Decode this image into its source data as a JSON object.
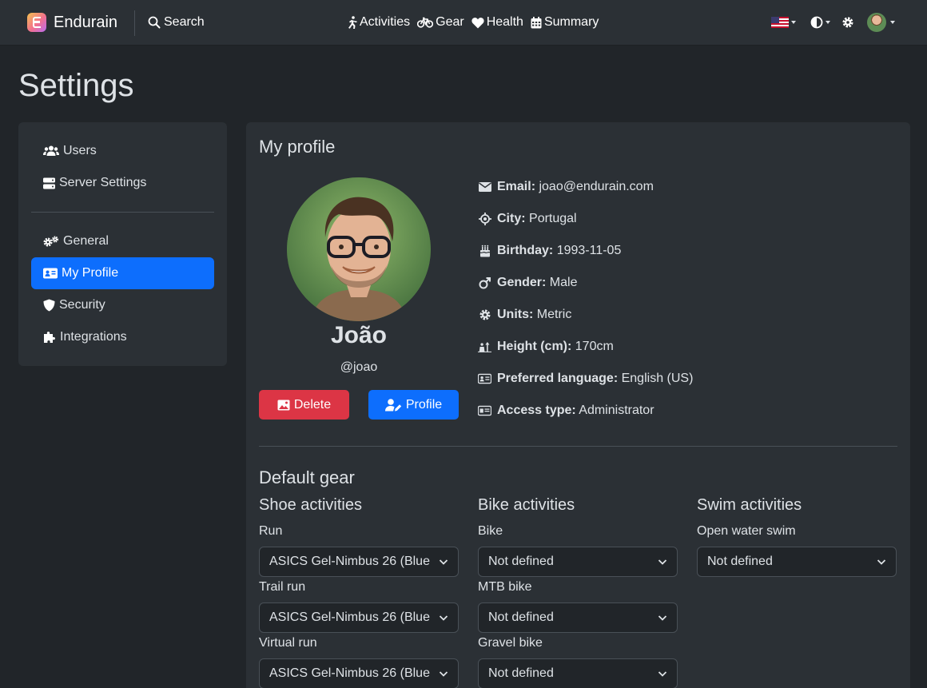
{
  "navbar": {
    "brand": "Endurain",
    "search": "Search",
    "links": [
      "Activities",
      "Gear",
      "Health",
      "Summary"
    ]
  },
  "page_title": "Settings",
  "sidebar": {
    "items": [
      "Users",
      "Server Settings",
      "General",
      "My Profile",
      "Security",
      "Integrations"
    ],
    "active": "My Profile"
  },
  "profile": {
    "heading": "My profile",
    "name": "João",
    "handle": "@joao",
    "delete_label": "Delete",
    "profile_label": "Profile",
    "fields": [
      {
        "label": "Email:",
        "value": "joao@endurain.com",
        "icon": "envelope-icon"
      },
      {
        "label": "City:",
        "value": "Portugal",
        "icon": "location-crosshair-icon"
      },
      {
        "label": "Birthday:",
        "value": "1993-11-05",
        "icon": "cake-icon"
      },
      {
        "label": "Gender:",
        "value": "Male",
        "icon": "mars-icon"
      },
      {
        "label": "Units:",
        "value": "Metric",
        "icon": "gear-icon"
      },
      {
        "label": "Height (cm):",
        "value": "170cm",
        "icon": "height-icon"
      },
      {
        "label": "Preferred language:",
        "value": "English (US)",
        "icon": "id-card-icon"
      },
      {
        "label": "Access type:",
        "value": "Administrator",
        "icon": "address-card-icon"
      }
    ]
  },
  "default_gear": {
    "heading": "Default gear",
    "columns": [
      {
        "title": "Shoe activities",
        "fields": [
          {
            "label": "Run",
            "value": "ASICS Gel-Nimbus 26 (Blue"
          },
          {
            "label": "Trail run",
            "value": "ASICS Gel-Nimbus 26 (Blue"
          },
          {
            "label": "Virtual run",
            "value": "ASICS Gel-Nimbus 26 (Blue"
          }
        ]
      },
      {
        "title": "Bike activities",
        "fields": [
          {
            "label": "Bike",
            "value": "Not defined"
          },
          {
            "label": "MTB bike",
            "value": "Not defined"
          },
          {
            "label": "Gravel bike",
            "value": "Not defined"
          }
        ]
      },
      {
        "title": "Swim activities",
        "fields": [
          {
            "label": "Open water swim",
            "value": "Not defined"
          }
        ]
      }
    ]
  },
  "colors": {
    "primary": "#0d6efd",
    "danger": "#dc3545",
    "background": "#212529",
    "surface": "#2b3035"
  }
}
